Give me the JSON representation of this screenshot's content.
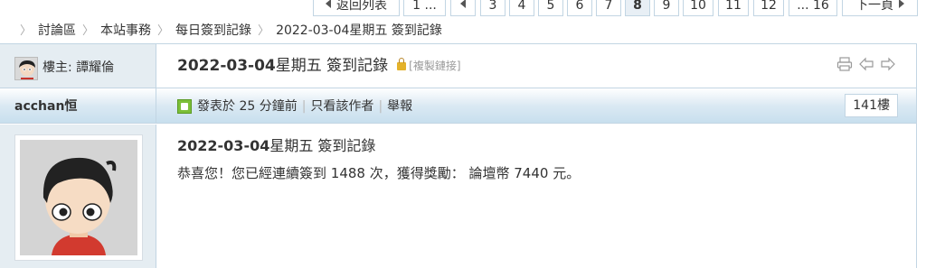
{
  "pagination": {
    "back_label": "返回列表",
    "first_partial": "1 ...",
    "pages": [
      "3",
      "4",
      "5",
      "6",
      "7",
      "8",
      "9",
      "10",
      "11",
      "12"
    ],
    "current": "8",
    "last_partial": "... 16",
    "next_label": "下一頁"
  },
  "breadcrumb": [
    "討論區",
    "本站事務",
    "每日簽到記錄",
    "2022-03-04星期五 簽到記錄"
  ],
  "thread": {
    "op_label": "樓主: 譚耀倫",
    "title_bold": "2022-03-04",
    "title_rest": "星期五 簽到記錄",
    "copy_link": "[複製鏈接]"
  },
  "post": {
    "author": "acchan恒",
    "posted": "發表於 25 分鐘前",
    "only_author": "只看該作者",
    "report": "舉報",
    "floor": "141樓",
    "title_bold": "2022-03-04",
    "title_rest": "星期五 簽到記錄",
    "message": "恭喜您！您已經連續簽到 1488 次，獲得獎勵： 論壇幣 7440 元。"
  },
  "icons": {
    "print": "print-icon",
    "prev": "prev-thread-icon",
    "next": "next-thread-icon",
    "lock": "lock-icon",
    "post": "post-icon"
  },
  "colors": {
    "border": "#c2d5e3",
    "side_bg": "#e5edf2",
    "lock": "#e4b22a",
    "post_icon": "#7cbf38"
  }
}
